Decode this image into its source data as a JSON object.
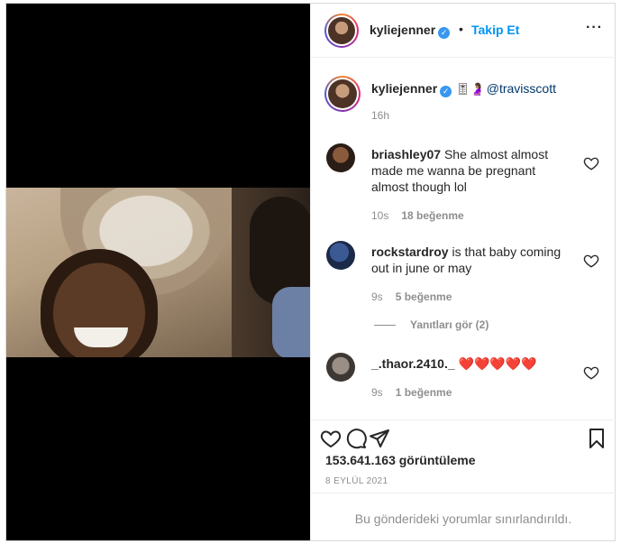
{
  "post": {
    "author": "kyliejenner",
    "follow_label": "Takip Et",
    "dot": "•",
    "more_label": "···",
    "verified_mark": "✓",
    "caption": {
      "username": "kyliejenner",
      "emojis": "🎚🤰🏽",
      "mention": "@travisscott",
      "time": "16h"
    },
    "comments": [
      {
        "username": "briashley07",
        "text": "She almost almost made me wanna be pregnant almost though lol",
        "time": "10s",
        "likes": "18 beğenme"
      },
      {
        "username": "rockstardroy",
        "text": "is that baby coming out in june or may",
        "time": "9s",
        "likes": "5 beğenme"
      },
      {
        "username": "_.thaor.2410._",
        "text": "❤️❤️❤️❤️❤️",
        "time": "9s",
        "likes": "1 beğenme"
      }
    ],
    "view_replies": "Yanıtları gör (2)",
    "views": "153.641.163 görüntüleme",
    "date": "8 EYLÜL 2021",
    "comments_limited": "Bu gönderideki yorumlar sınırlandırıldı."
  },
  "icons": {
    "verified": "verified-badge-icon",
    "heart": "heart-outline-icon",
    "comment": "comment-bubble-icon",
    "share": "paper-plane-icon",
    "save": "bookmark-icon",
    "more": "more-dots-icon"
  },
  "colors": {
    "accent": "#0095f6",
    "verified": "#3897f0",
    "text": "#262626",
    "muted": "#8e8e8e",
    "mention": "#00376b"
  }
}
